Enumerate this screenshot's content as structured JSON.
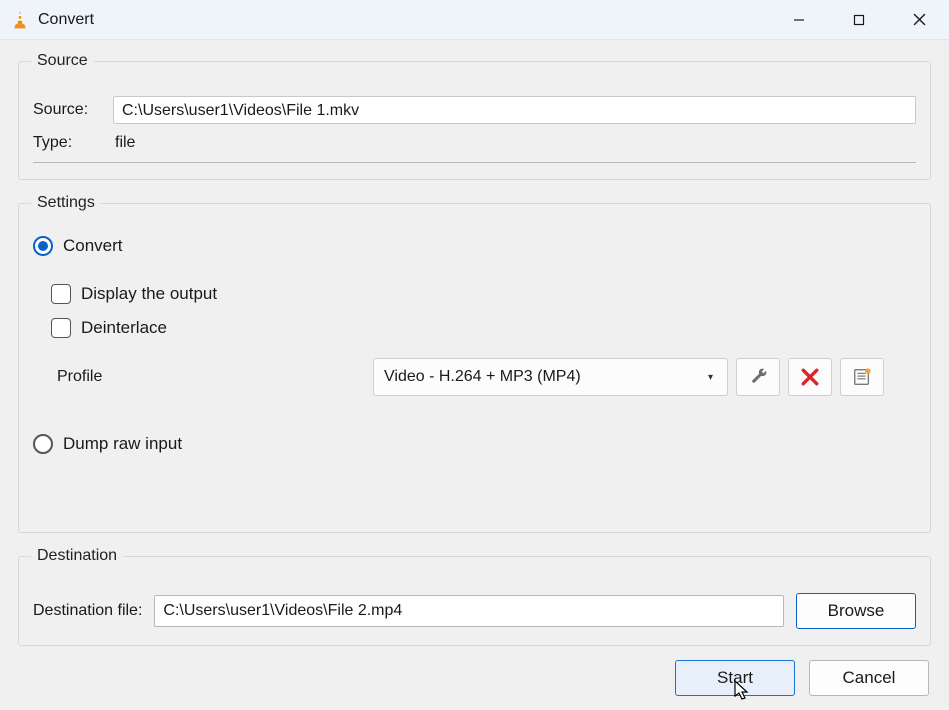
{
  "window": {
    "title": "Convert"
  },
  "source": {
    "legend": "Source",
    "source_label": "Source:",
    "source_value": "C:\\Users\\user1\\Videos\\File 1.mkv",
    "type_label": "Type:",
    "type_value": "file"
  },
  "settings": {
    "legend": "Settings",
    "convert_label": "Convert",
    "display_output_label": "Display the output",
    "deinterlace_label": "Deinterlace",
    "profile_label": "Profile",
    "profile_value": "Video - H.264 + MP3 (MP4)",
    "dump_raw_label": "Dump raw input"
  },
  "destination": {
    "legend": "Destination",
    "label": "Destination file:",
    "value": "C:\\Users\\user1\\Videos\\File 2.mp4",
    "browse_label": "Browse"
  },
  "footer": {
    "start_label": "Start",
    "cancel_label": "Cancel"
  }
}
